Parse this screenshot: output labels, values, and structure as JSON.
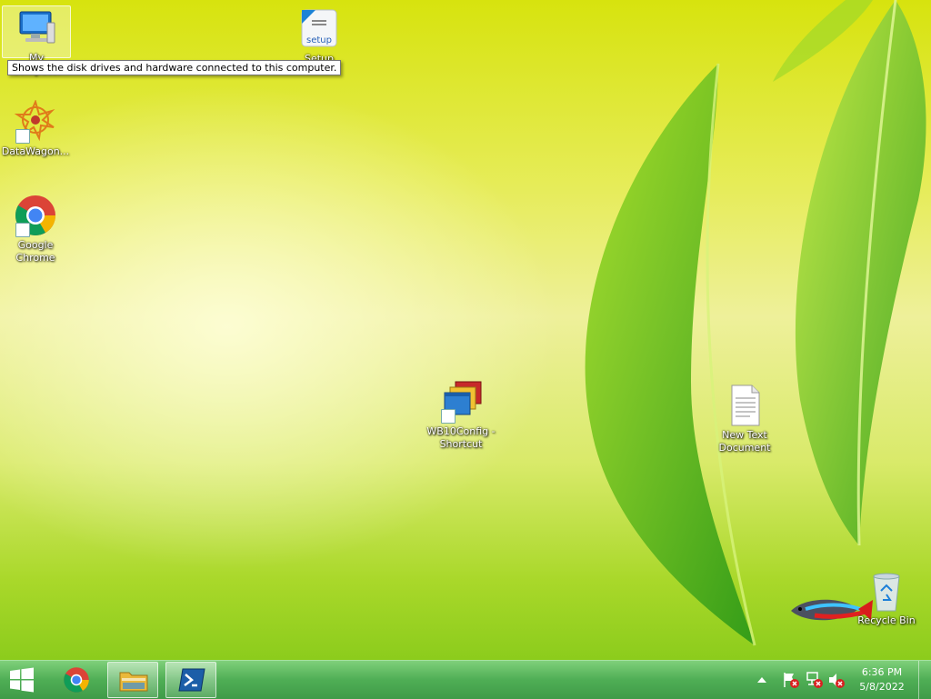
{
  "desktop": {
    "icons": {
      "my_computer": {
        "label": "My Computer"
      },
      "setup": {
        "label": "Setup",
        "img_text": "setup"
      },
      "datawagon": {
        "label": "DataWagon..."
      },
      "chrome": {
        "label": "Google Chrome"
      },
      "wb10config": {
        "label": "WB10Config - Shortcut"
      },
      "new_text": {
        "label": "New Text Document"
      },
      "recycle_bin": {
        "label": "Recycle Bin"
      }
    },
    "tooltip": "Shows the disk drives and hardware connected to this computer."
  },
  "taskbar": {
    "clock": {
      "time": "6:36 PM",
      "date": "5/8/2022"
    },
    "accent": "#4fae55"
  }
}
